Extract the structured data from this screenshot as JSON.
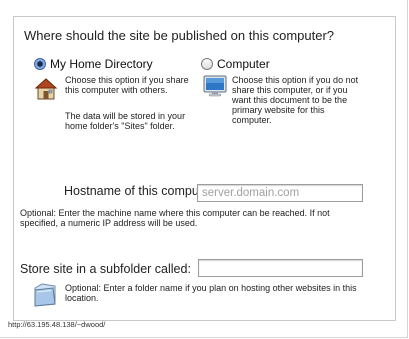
{
  "question": "Where should the site be published on this computer?",
  "options": [
    {
      "label": "My Home Directory",
      "selected": true,
      "icon": "home-icon",
      "desc": [
        "Choose this option if you share",
        "this computer with others."
      ],
      "note": [
        "The data will be stored in your",
        "home folder's \"Sites\" folder."
      ]
    },
    {
      "label": "Computer",
      "selected": false,
      "icon": "monitor-icon",
      "desc": [
        "Choose this option if you do not",
        "share this computer, or if you",
        "want this document to be the",
        "primary website for this",
        "computer."
      ]
    }
  ],
  "hostname": {
    "label": "Hostname of this computer:",
    "placeholder": "server.domain.com",
    "help": [
      "Optional: Enter the machine name where this computer can be reached.  If not",
      "specified, a numeric IP address will be used."
    ]
  },
  "subfolder": {
    "label": "Store site in a subfolder called:",
    "value": "",
    "help": [
      "Optional: Enter a folder name if you plan on hosting other websites in this",
      "location."
    ]
  },
  "footer_url": "http://63.195.48.138/~dwood/",
  "colors": {
    "accent": "#3a5f9a",
    "placeholder": "#a0a0a0",
    "border": "#c9c9c9"
  }
}
